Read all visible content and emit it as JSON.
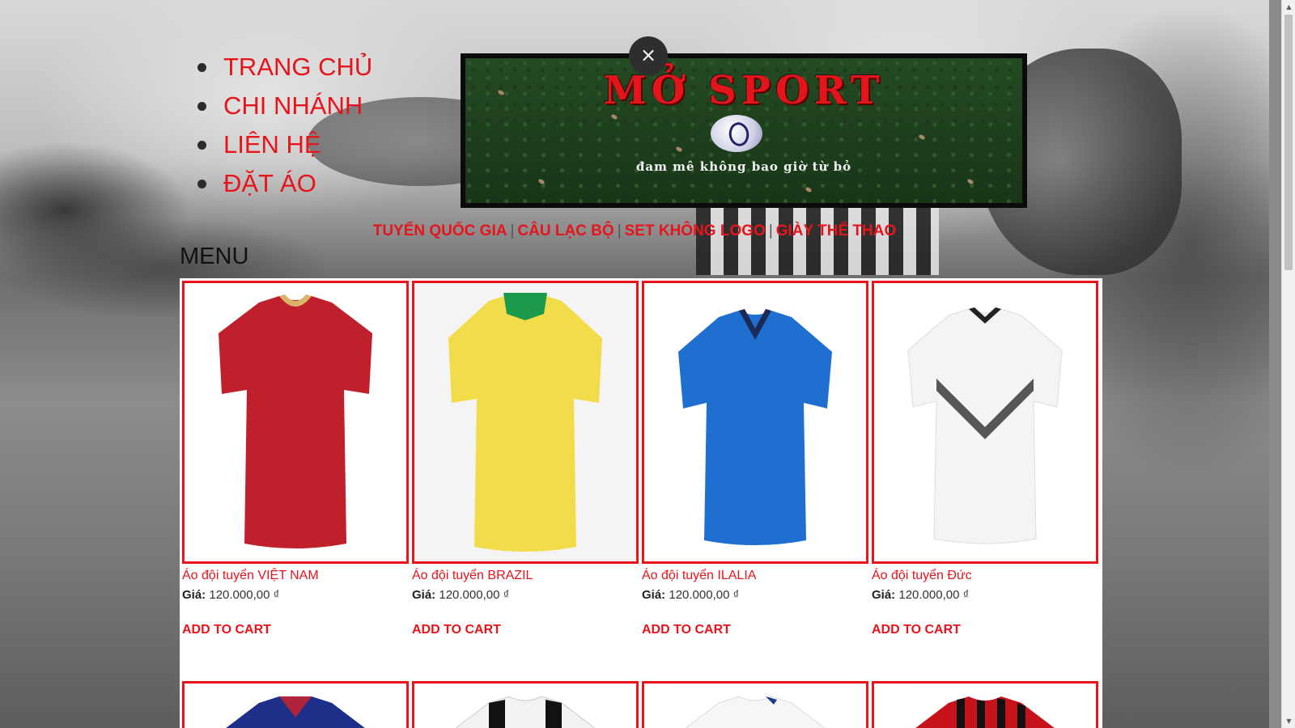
{
  "nav": {
    "items": [
      {
        "label": "TRANG CHỦ"
      },
      {
        "label": "CHI NHÁNH"
      },
      {
        "label": "LIÊN HỆ"
      },
      {
        "label": "ĐẶT ÁO"
      }
    ]
  },
  "banner": {
    "brand": "MỞ SPORT",
    "tagline": "đam mê không bao giờ từ bỏ",
    "close_symbol": "×"
  },
  "categories": [
    {
      "label": "TUYỂN QUỐC GIA"
    },
    {
      "label": "CÂU LẠC BỘ"
    },
    {
      "label": "SET KHÔNG LOGO"
    },
    {
      "label": "GIÀY THỂ THAO"
    }
  ],
  "category_separator": "|",
  "menu": {
    "title": "MENU"
  },
  "products": [
    {
      "name": "Áo đội tuyển VIỆT NAM",
      "price_label": "Giá:",
      "price": "120.000,00 ₫",
      "add_label": "ADD TO CART",
      "colors": {
        "body": "#c0202b",
        "trim": "#d9b46a"
      }
    },
    {
      "name": "Áo đội tuyển BRAZIL",
      "price_label": "Giá:",
      "price": "120.000,00 ₫",
      "add_label": "ADD TO CART",
      "colors": {
        "body": "#f3dc4a",
        "trim": "#1a9a4a"
      }
    },
    {
      "name": "Áo đội tuyển ILALIA",
      "price_label": "Giá:",
      "price": "120.000,00 ₫",
      "add_label": "ADD TO CART",
      "colors": {
        "body": "#1f6fd0",
        "trim": "#1b2a55"
      }
    },
    {
      "name": "Áo đội tuyển Đức",
      "price_label": "Giá:",
      "price": "120.000,00 ₫",
      "add_label": "ADD TO CART",
      "colors": {
        "body": "#f4f4f4",
        "trim": "#222222"
      }
    }
  ],
  "products_row2": [
    {
      "colors": {
        "body": "#1e2f8a",
        "trim": "#b0233a"
      }
    },
    {
      "colors": {
        "body": "#f2f2f2",
        "trim": "#111111"
      }
    },
    {
      "colors": {
        "body": "#f6f6f6",
        "trim": "#1a3a8a"
      }
    },
    {
      "colors": {
        "body": "#c5121b",
        "trim": "#111111"
      }
    }
  ],
  "theme": {
    "accent": "#e8141b",
    "panel_bg": "#ffffff"
  }
}
